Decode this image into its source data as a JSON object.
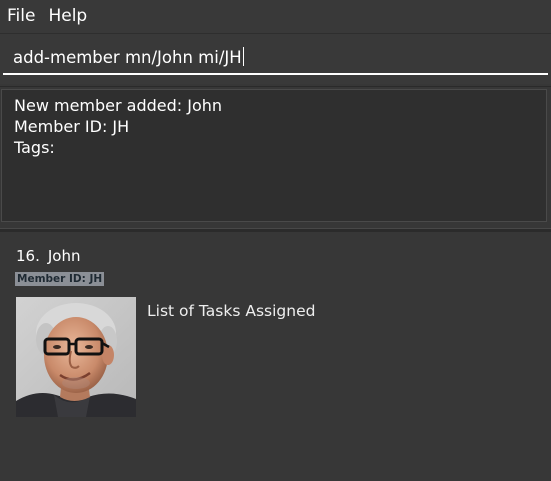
{
  "menu": {
    "file_label": "File",
    "help_label": "Help"
  },
  "command_box": {
    "value": "add-member mn/John mi/JH"
  },
  "result_display": {
    "lines": [
      "New member added: John",
      "Member ID: JH",
      "Tags:"
    ]
  },
  "member_list": {
    "members": [
      {
        "index": "16.",
        "name": "John",
        "member_id_label": "Member ID: JH",
        "tasks_heading": "List of Tasks Assigned"
      }
    ]
  },
  "colors": {
    "background": "#373737",
    "result_background": "#2f2f2f",
    "badge_background": "#8b8f96",
    "text": "#ffffff"
  }
}
